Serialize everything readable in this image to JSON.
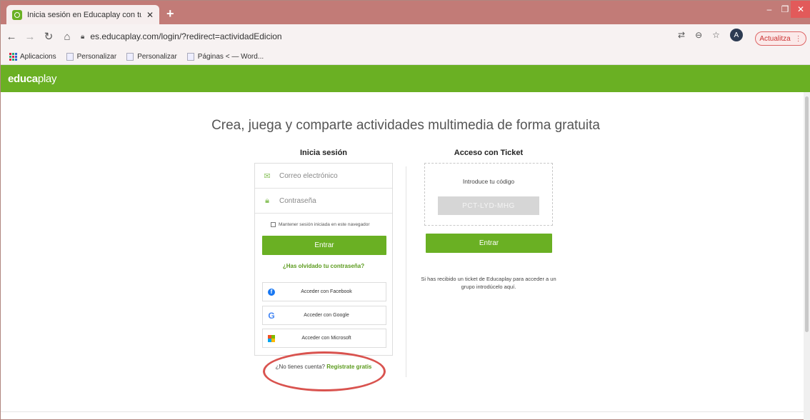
{
  "browser": {
    "tab_title": "Inicia sesión en Educaplay con tu",
    "tab_close": "✕",
    "new_tab": "+",
    "url": "es.educaplay.com/login/?redirect=actividadEdicion",
    "avatar_letter": "A",
    "update_label": "Actualitza",
    "bookmarks": [
      "Aplicacions",
      "Personalizar",
      "Personalizar",
      "Páginas < — Word..."
    ]
  },
  "site": {
    "logo_bold": "educa",
    "logo_rest": "play",
    "headline": "Crea, juega y comparte actividades multimedia de forma gratuita"
  },
  "login": {
    "title": "Inicia sesión",
    "email_placeholder": "Correo electrónico",
    "password_placeholder": "Contraseña",
    "keep_session": "Mantener sesión iniciada en este navegador",
    "enter_label": "Entrar",
    "forgot_label": "¿Has olvidado tu contraseña?",
    "facebook_label": "Acceder con Facebook",
    "google_label": "Acceder con Google",
    "microsoft_label": "Acceder con Microsoft",
    "no_account": "¿No tienes cuenta?",
    "register_label": "Regístrate gratis"
  },
  "ticket": {
    "title": "Acceso con Ticket",
    "code_label": "Introduce tu código",
    "code_placeholder": "PCT-LYD-MHG",
    "enter_label": "Entrar",
    "info": "Si has recibido un ticket de Educaplay para acceder a un grupo introdúcelo aquí."
  },
  "colors": {
    "brand_green": "#6ab023",
    "highlight_red": "#d9534f",
    "tabstrip": "#c27b77"
  }
}
